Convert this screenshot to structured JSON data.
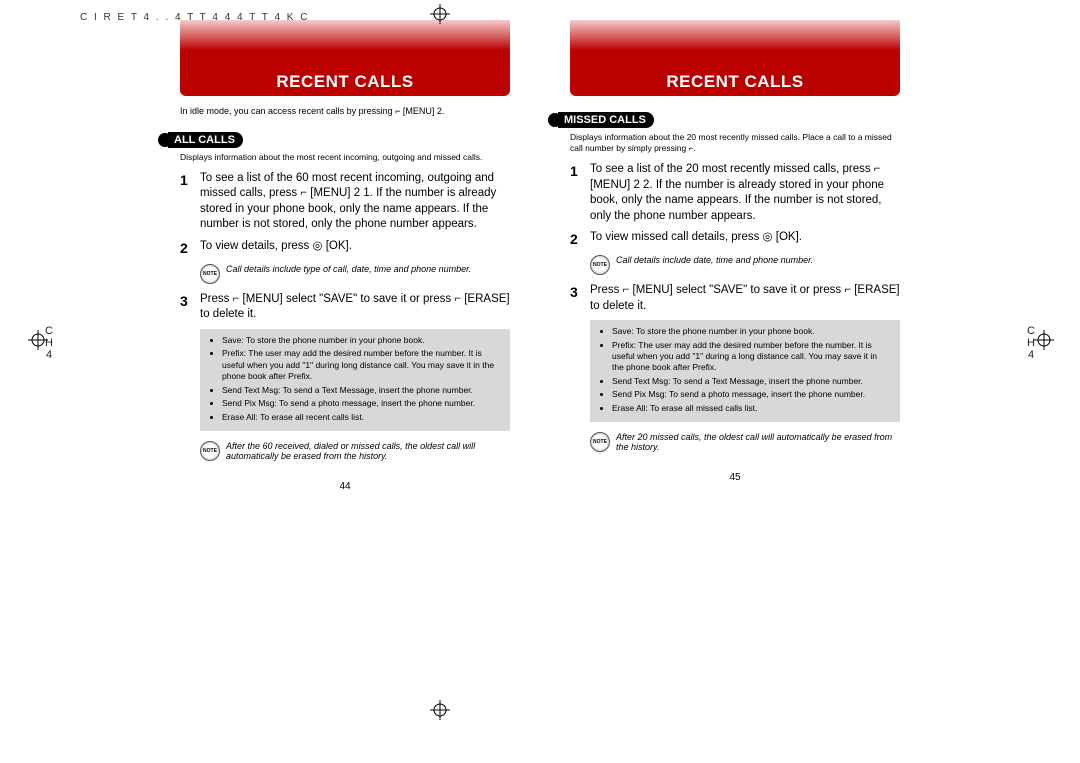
{
  "top_header": "C I R E T 4 .       . 4   T   T 4     4 4     T   T 4       K     C",
  "left": {
    "title": "RECENT CALLS",
    "intro": "In idle mode, you can access recent calls by pressing ⌐ [MENU] 2.",
    "section": "ALL CALLS",
    "section_sub": "Displays information about the most recent incoming, outgoing and missed calls.",
    "step1": "To see a list of the 60 most recent incoming, outgoing and missed calls, press ⌐ [MENU] 2 1. If the number is already stored in your phone book, only the name appears. If the number is not stored, only the phone number appears.",
    "step2": "To view details, press ◎ [OK].",
    "note1": "Call details include type of call, date, time and phone number.",
    "step3": "Press ⌐ [MENU] select \"SAVE\" to save it or press ⌐ [ERASE] to delete it.",
    "box_items": [
      "Save: To store the phone number in your phone book.",
      "Prefix: The user may add the desired number before the number. It is useful when you add \"1\" during long distance call. You may save it in the phone book after Prefix.",
      "Send Text Msg: To send a Text Message, insert the phone number.",
      "Send Pix Msg: To send a photo message, insert the phone number.",
      "Erase All: To erase all recent calls list."
    ],
    "note2": "After the 60 received, dialed or missed calls, the oldest call will automatically be erased from the history.",
    "page_num": "44",
    "ch_label": "C\nH\n4"
  },
  "right": {
    "title": "RECENT CALLS",
    "section": "MISSED CALLS",
    "section_sub": "Displays information about the 20 most recently missed calls. Place a call to a missed call number by simply pressing ⌐.",
    "step1": "To see a list of the 20 most recently missed calls, press ⌐ [MENU] 2 2. If the number is already stored in your phone book, only the name appears. If the number is not stored, only the phone number appears.",
    "step2": "To view missed call details, press ◎ [OK].",
    "note1": "Call details include date, time and phone number.",
    "step3": "Press ⌐ [MENU] select \"SAVE\" to save it or press ⌐ [ERASE] to delete it.",
    "box_items": [
      "Save: To store the phone number in your phone book.",
      "Prefix: The user may add the desired number before the number. It is useful when you add \"1\" during a long distance call. You may save it in the phone book after Prefix.",
      "Send Text Msg: To send a Text Message, insert the phone number.",
      "Send Pix Msg: To send a photo message, insert the phone number.",
      "Erase All: To erase all missed calls list."
    ],
    "note2": "After 20 missed calls, the oldest call will automatically be erased from the history.",
    "page_num": "45",
    "ch_label": "C\nH\n4"
  }
}
